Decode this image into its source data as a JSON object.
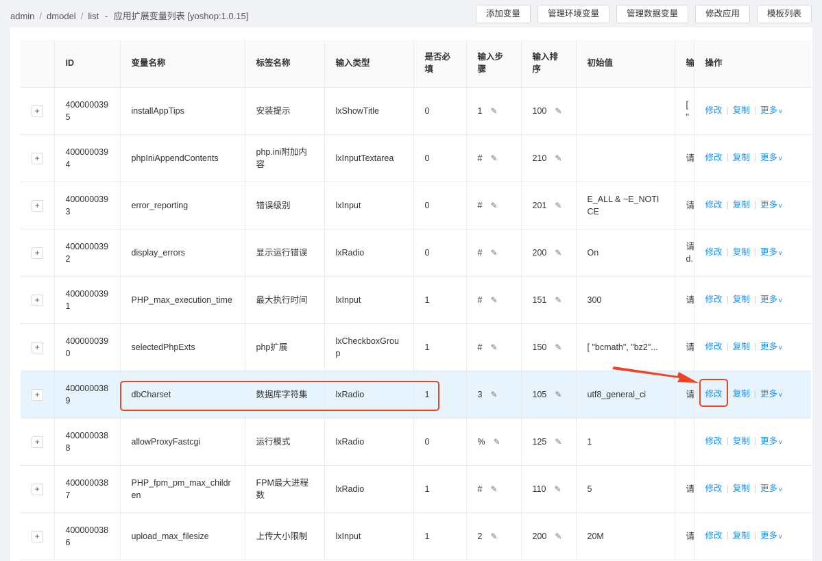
{
  "breadcrumb": [
    "admin",
    "dmodel",
    "list",
    "应用扩展变量列表 [yoshop:1.0.15]"
  ],
  "breadcrumb_title_prefix": "-",
  "toolbar": {
    "buttons": [
      "添加变量",
      "管理环境变量",
      "管理数据变量",
      "修改应用",
      "模板列表"
    ]
  },
  "table": {
    "headers": {
      "id": "ID",
      "name": "变量名称",
      "label": "标签名称",
      "type": "输入类型",
      "required": "是否必填",
      "step": "输入步骤",
      "sort": "输入排序",
      "initial": "初始值",
      "desc": "输",
      "ops": "操作"
    },
    "expand_symbol": "+",
    "edit_icon": "pencil-icon",
    "op_labels": {
      "edit": "修改",
      "copy": "复制",
      "more": "更多"
    },
    "rows": [
      {
        "id": "4000000395",
        "name": "installAppTips",
        "label": "安装提示",
        "type": "lxShowTitle",
        "required": "0",
        "step": "1",
        "sort": "100",
        "initial": "",
        "desc": "[ \"",
        "highlight": false
      },
      {
        "id": "4000000394",
        "name": "phpIniAppendContents",
        "label": "php.ini附加内容",
        "type": "lxInputTextarea",
        "required": "0",
        "step": "#",
        "sort": "210",
        "initial": "",
        "desc": "请",
        "highlight": false
      },
      {
        "id": "4000000393",
        "name": "error_reporting",
        "label": "错误级别",
        "type": "lxInput",
        "required": "0",
        "step": "#",
        "sort": "201",
        "initial": "E_ALL & ~E_NOTICE",
        "desc": "请",
        "highlight": false
      },
      {
        "id": "4000000392",
        "name": "display_errors",
        "label": "显示运行错误",
        "type": "lxRadio",
        "required": "0",
        "step": "#",
        "sort": "200",
        "initial": "On",
        "desc": "请 d.",
        "highlight": false
      },
      {
        "id": "4000000391",
        "name": "PHP_max_execution_time",
        "label": "最大执行时间",
        "type": "lxInput",
        "required": "1",
        "step": "#",
        "sort": "151",
        "initial": "300",
        "desc": "请",
        "highlight": false
      },
      {
        "id": "4000000390",
        "name": "selectedPhpExts",
        "label": "php扩展",
        "type": "lxCheckboxGroup",
        "required": "1",
        "step": "#",
        "sort": "150",
        "initial": "[ \"bcmath\", \"bz2\"...",
        "desc": "请",
        "highlight": false
      },
      {
        "id": "4000000389",
        "name": "dbCharset",
        "label": "数据库字符集",
        "type": "lxRadio",
        "required": "1",
        "step": "3",
        "sort": "105",
        "initial": "utf8_general_ci",
        "desc": "请",
        "highlight": true
      },
      {
        "id": "4000000388",
        "name": "allowProxyFastcgi",
        "label": "运行模式",
        "type": "lxRadio",
        "required": "0",
        "step": "%",
        "sort": "125",
        "initial": "1",
        "desc": "",
        "highlight": false
      },
      {
        "id": "4000000387",
        "name": "PHP_fpm_pm_max_children",
        "label": "FPM最大进程数",
        "type": "lxRadio",
        "required": "1",
        "step": "#",
        "sort": "110",
        "initial": "5",
        "desc": "请",
        "highlight": false
      },
      {
        "id": "4000000386",
        "name": "upload_max_filesize",
        "label": "上传大小限制",
        "type": "lxInput",
        "required": "1",
        "step": "2",
        "sort": "200",
        "initial": "20M",
        "desc": "请",
        "highlight": false
      }
    ]
  },
  "annotation_color": "#ee4422",
  "link_color": "#1890ff"
}
